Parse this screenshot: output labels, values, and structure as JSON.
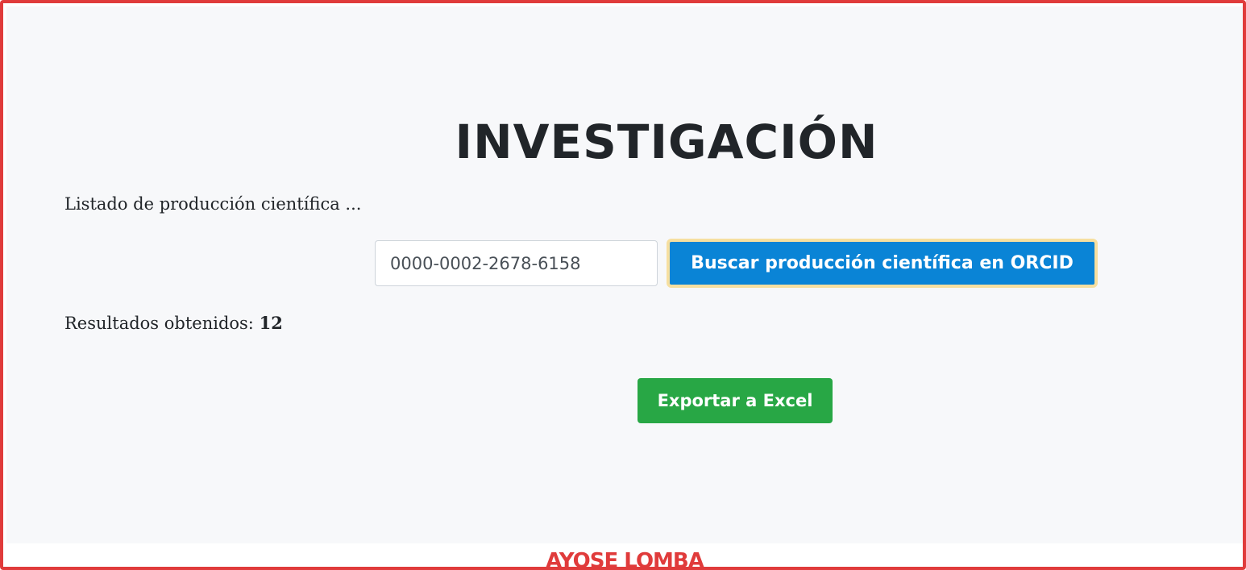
{
  "page": {
    "title": "INVESTIGACIÓN",
    "listing_label": "Listado de producción científica ..."
  },
  "search": {
    "orcid_value": "0000-0002-2678-6158",
    "button_label": "Buscar producción científica en ORCID"
  },
  "results": {
    "label": "Resultados obtenidos:",
    "count": "12"
  },
  "export": {
    "button_label": "Exportar a Excel"
  },
  "watermark": {
    "text": "AYOSE LOMBA"
  },
  "colors": {
    "frame_border": "#e03b3b",
    "background": "#f7f8fa",
    "primary_button": "#0a84d6",
    "focus_ring": "#f6dfa0",
    "success_button": "#28a745",
    "text": "#212529"
  }
}
